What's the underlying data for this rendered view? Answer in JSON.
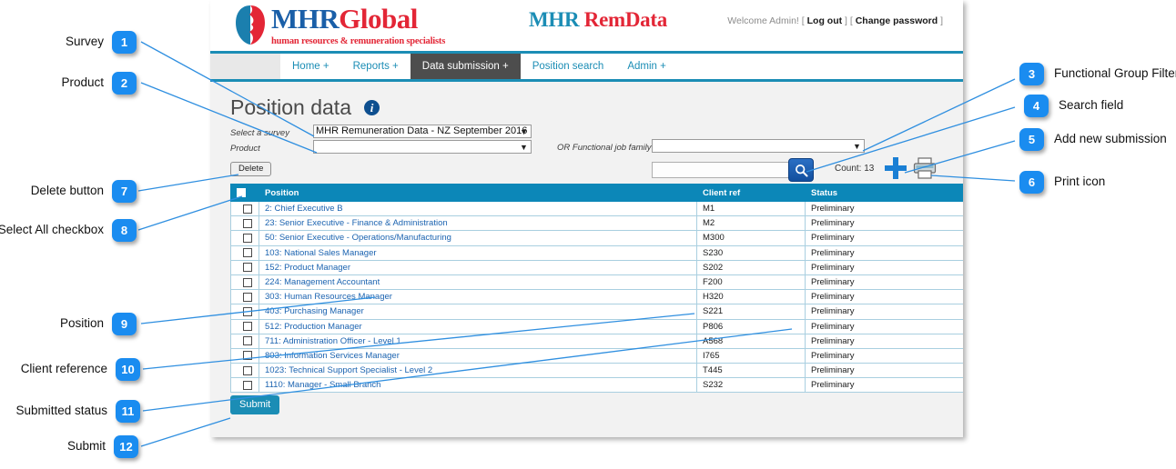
{
  "app": {
    "logo": {
      "part1": "MHR",
      "part2": "Global",
      "tagline": "human resources & remuneration specialists"
    },
    "brand": {
      "part1": "MHR",
      "part2": "RemData"
    },
    "welcome": {
      "greeting": "Welcome Admin!",
      "open_bracket": "[",
      "logout": "Log out",
      "mid_brackets": "] [",
      "change_password": "Change password",
      "close_bracket": "]"
    },
    "nav": [
      {
        "label": "Home +",
        "active": false
      },
      {
        "label": "Reports +",
        "active": false
      },
      {
        "label": "Data submission +",
        "active": true
      },
      {
        "label": "Position search",
        "active": false
      },
      {
        "label": "Admin +",
        "active": false
      }
    ],
    "page_title": "Position data",
    "info_icon": "info-icon",
    "form": {
      "survey_label": "Select a survey",
      "survey_value": "MHR Remuneration Data - NZ September 2016",
      "product_label": "Product",
      "product_value": "",
      "family_label": "OR Functional job family",
      "family_value": ""
    },
    "toolbar": {
      "delete_label": "Delete",
      "search_value": "",
      "search_placeholder": "",
      "search_icon": "magnifier-icon",
      "count_label": "Count: 13",
      "add_icon": "plus-icon",
      "print_icon": "printer-icon",
      "submit_label": "Submit"
    },
    "table": {
      "headers": [
        "",
        "Position",
        "Client ref",
        "Status"
      ],
      "rows": [
        {
          "position": "2: Chief Executive B",
          "client_ref": "M1",
          "status": "Preliminary"
        },
        {
          "position": "23: Senior Executive - Finance & Administration",
          "client_ref": "M2",
          "status": "Preliminary"
        },
        {
          "position": "50: Senior Executive - Operations/Manufacturing",
          "client_ref": "M300",
          "status": "Preliminary"
        },
        {
          "position": "103: National Sales Manager",
          "client_ref": "S230",
          "status": "Preliminary"
        },
        {
          "position": "152: Product Manager",
          "client_ref": "S202",
          "status": "Preliminary"
        },
        {
          "position": "224: Management Accountant",
          "client_ref": "F200",
          "status": "Preliminary"
        },
        {
          "position": "303: Human Resources Manager",
          "client_ref": "H320",
          "status": "Preliminary"
        },
        {
          "position": "403: Purchasing Manager",
          "client_ref": "S221",
          "status": "Preliminary"
        },
        {
          "position": "512: Production Manager",
          "client_ref": "P806",
          "status": "Preliminary"
        },
        {
          "position": "711: Administration Officer - Level 1",
          "client_ref": "A568",
          "status": "Preliminary"
        },
        {
          "position": "803: Information Services Manager",
          "client_ref": "I765",
          "status": "Preliminary"
        },
        {
          "position": "1023: Technical Support Specialist - Level 2",
          "client_ref": "T445",
          "status": "Preliminary"
        },
        {
          "position": "1110: Manager - Small Branch",
          "client_ref": "S232",
          "status": "Preliminary"
        }
      ]
    }
  },
  "annotations": {
    "accent_color": "#1a8cf0",
    "left": [
      {
        "num": "1",
        "label": "Survey"
      },
      {
        "num": "2",
        "label": "Product"
      },
      {
        "num": "7",
        "label": "Delete button"
      },
      {
        "num": "8",
        "label": "Select All checkbox"
      },
      {
        "num": "9",
        "label": "Position"
      },
      {
        "num": "10",
        "label": "Client reference"
      },
      {
        "num": "11",
        "label": "Submitted status"
      },
      {
        "num": "12",
        "label": "Submit"
      }
    ],
    "right": [
      {
        "num": "3",
        "label": "Functional Group Filter"
      },
      {
        "num": "4",
        "label": "Search field"
      },
      {
        "num": "5",
        "label": "Add new submission"
      },
      {
        "num": "6",
        "label": "Print icon"
      }
    ]
  }
}
